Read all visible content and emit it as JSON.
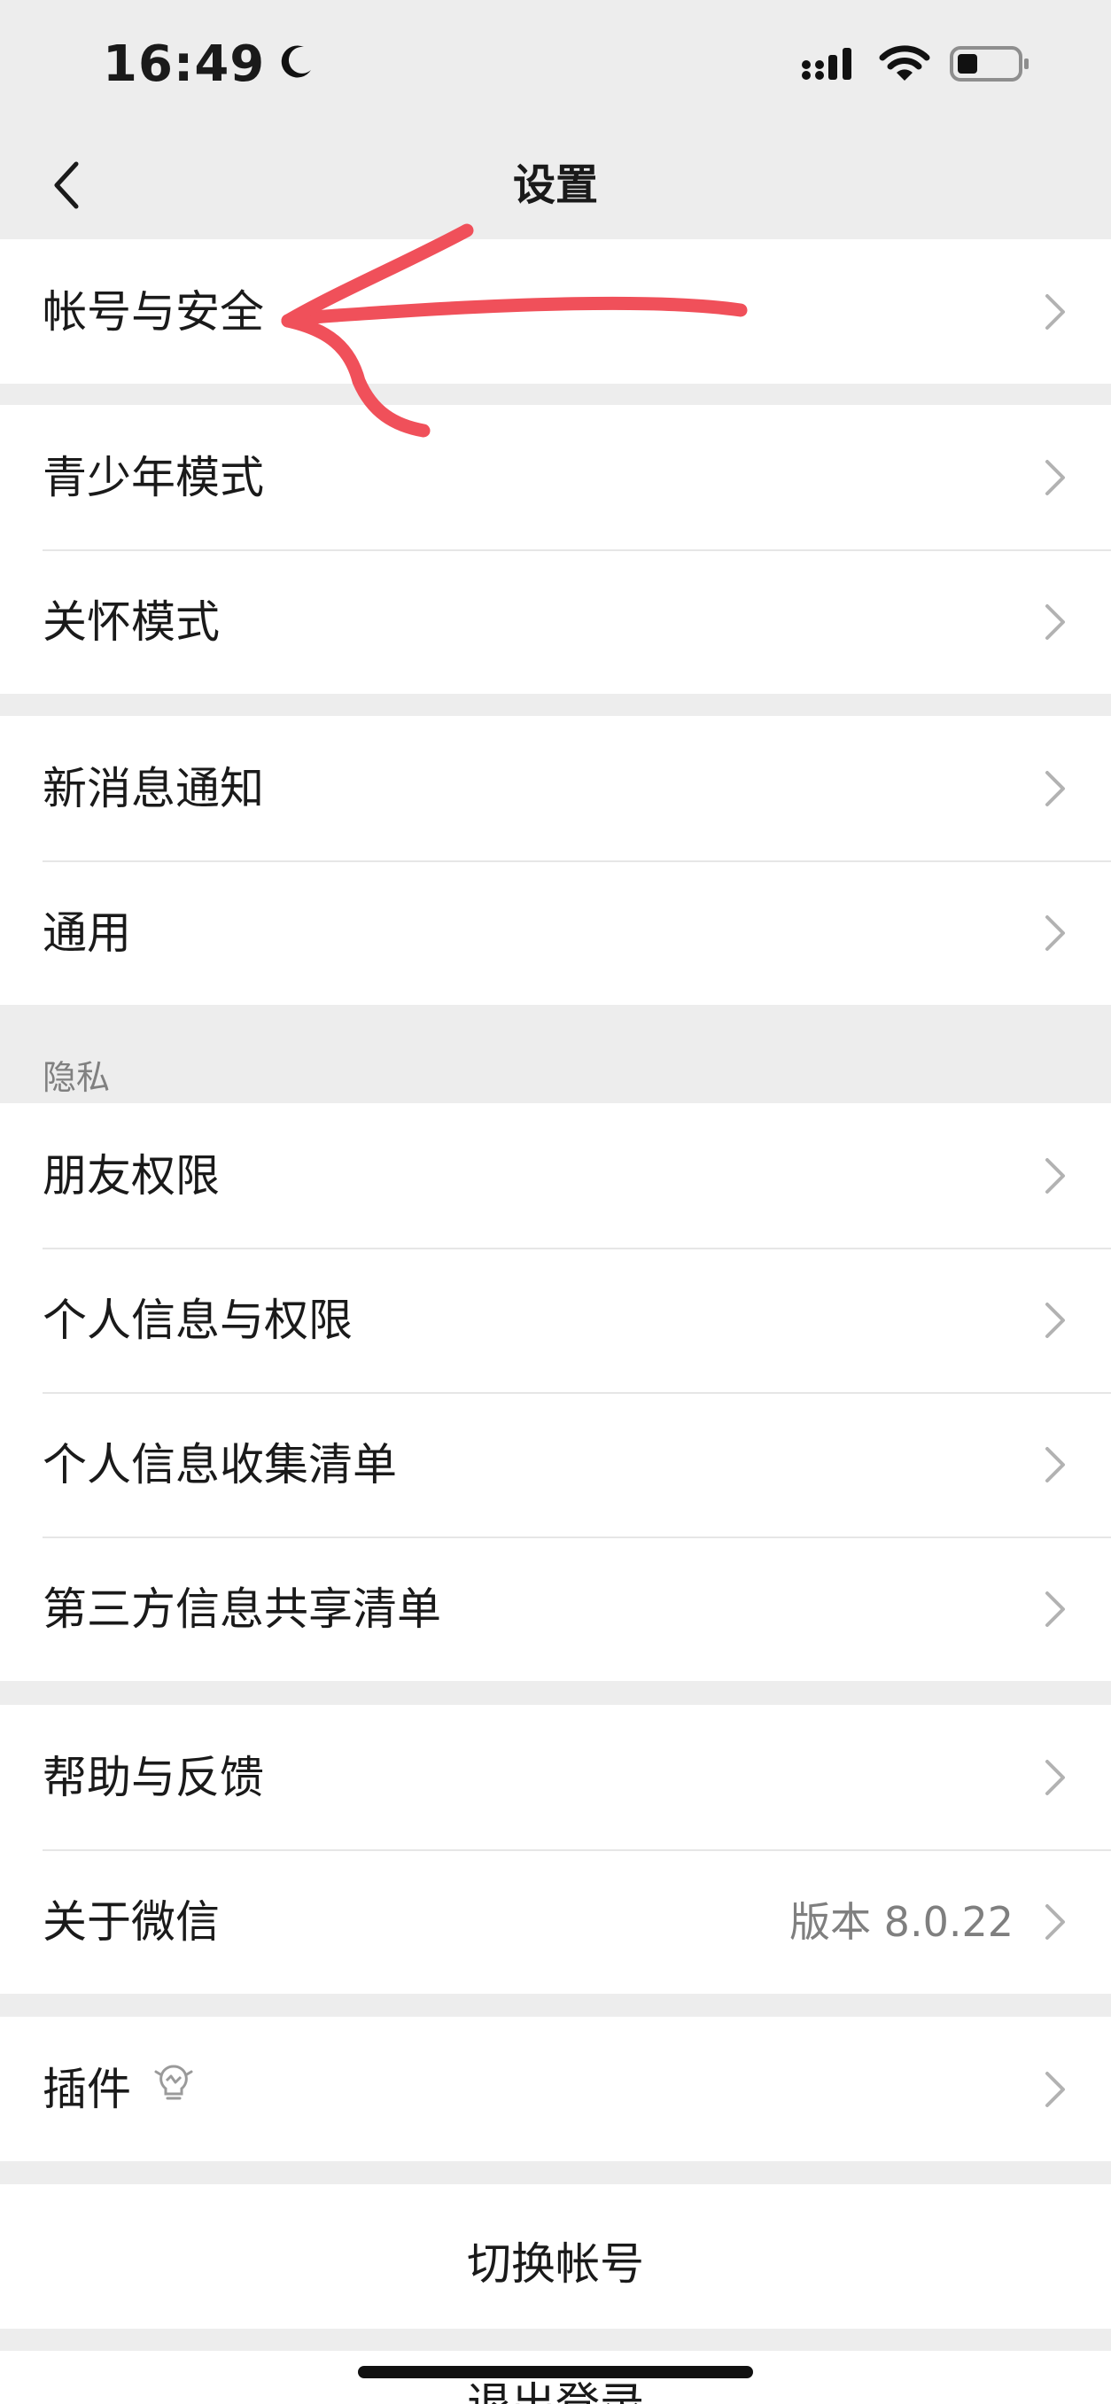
{
  "status_bar": {
    "time": "16:49",
    "icons": [
      "moon-icon",
      "signal-icon",
      "wifi-icon",
      "battery-icon"
    ]
  },
  "nav": {
    "title": "设置",
    "back_icon": "chevron-left-icon"
  },
  "groups": {
    "account": {
      "items": [
        {
          "label": "帐号与安全"
        }
      ]
    },
    "modes": {
      "items": [
        {
          "label": "青少年模式"
        },
        {
          "label": "关怀模式"
        }
      ]
    },
    "notifications": {
      "items": [
        {
          "label": "新消息通知"
        },
        {
          "label": "通用"
        }
      ]
    },
    "privacy": {
      "header": "隐私",
      "items": [
        {
          "label": "朋友权限"
        },
        {
          "label": "个人信息与权限"
        },
        {
          "label": "个人信息收集清单"
        },
        {
          "label": "第三方信息共享清单"
        }
      ]
    },
    "about": {
      "items": [
        {
          "label": "帮助与反馈"
        },
        {
          "label": "关于微信",
          "value": "版本 8.0.22"
        }
      ]
    },
    "plugins": {
      "items": [
        {
          "label": "插件",
          "icon": "lightbulb-icon"
        }
      ]
    },
    "switch_account": {
      "label": "切换帐号"
    },
    "logout": {
      "label": "退出登录"
    }
  },
  "colors": {
    "background": "#ededed",
    "cell": "#ffffff",
    "annotation": "#f0505a",
    "secondary_text": "#7f7f7f"
  }
}
